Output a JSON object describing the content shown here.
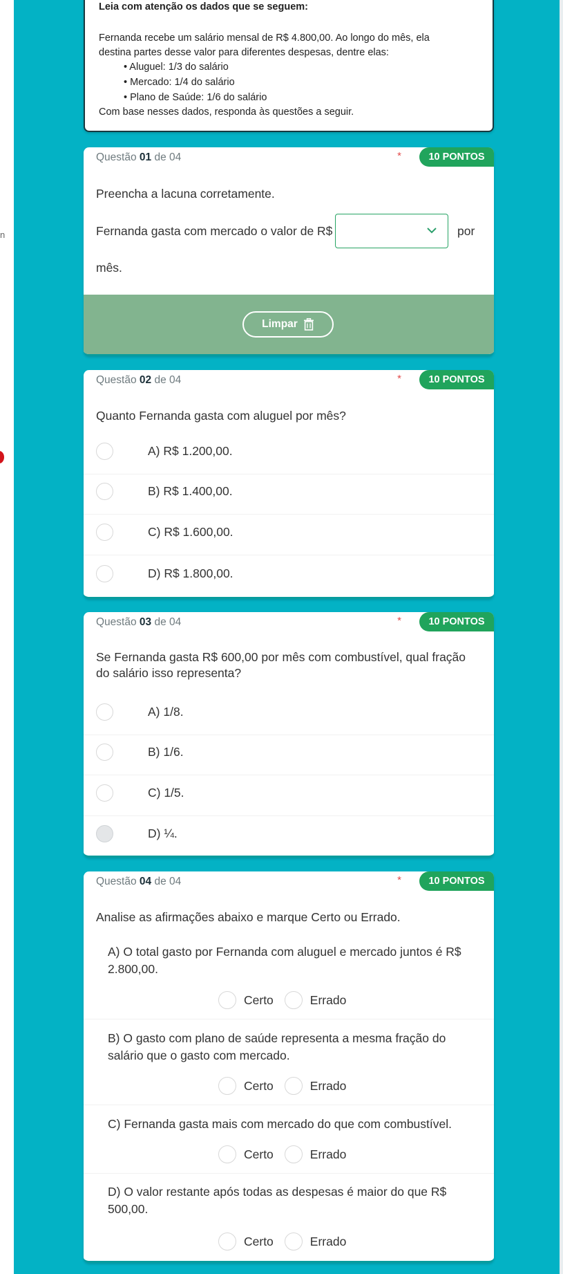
{
  "intro": {
    "title": "Leia com atenção os dados que se seguem:",
    "line1": "Fernanda recebe um salário mensal de R$ 4.800,00. Ao longo do mês, ela",
    "line2": "destina partes desse valor para diferentes despesas, dentre elas:",
    "bullets": [
      "• Aluguel: 1/3 do salário",
      "• Mercado: 1/4 do salário",
      "• Plano de Saúde: 1/6 do salário"
    ],
    "closing": "Com base nesses dados, responda às questões a seguir."
  },
  "left_edge_text": "n",
  "questions": [
    {
      "prefix": "Questão",
      "number": "01",
      "of": "de 04",
      "star": "*",
      "points": "10 PONTOS",
      "instruction": "Preencha a lacuna corretamente.",
      "sentence_before": "Fernanda gasta com mercado o valor de R$",
      "sentence_after": "por",
      "sentence_end": "mês.",
      "dropdown_value": "",
      "clear_label": "Limpar"
    },
    {
      "prefix": "Questão",
      "number": "02",
      "of": "de 04",
      "star": "*",
      "points": "10 PONTOS",
      "text": "Quanto Fernanda gasta com aluguel por mês?",
      "options": [
        "A) R$ 1.200,00.",
        "B) R$ 1.400,00.",
        "C) R$ 1.600,00.",
        "D) R$ 1.800,00."
      ]
    },
    {
      "prefix": "Questão",
      "number": "03",
      "of": "de 04",
      "star": "*",
      "points": "10 PONTOS",
      "text_line1": "Se Fernanda gasta R$ 600,00 por mês com combustível, qual fração",
      "text_line2": "do salário isso representa?",
      "options": [
        "A) 1/8.",
        "B) 1/6.",
        "C) 1/5.",
        "D) ¼."
      ]
    },
    {
      "prefix": "Questão",
      "number": "04",
      "of": "de 04",
      "star": "*",
      "points": "10 PONTOS",
      "text": "Analise as afirmações abaixo e marque Certo ou Errado.",
      "certo": "Certo",
      "errado": "Errado",
      "statements": [
        [
          "A) O total gasto por Fernanda com aluguel e mercado juntos é R$",
          "2.800,00."
        ],
        [
          "B) O gasto com plano de saúde representa a mesma fração do",
          "salário que o gasto com mercado."
        ],
        [
          "C) Fernanda gasta mais com mercado do que com combustível."
        ],
        [
          "D) O valor restante após todas as despesas é maior do que R$",
          "500,00."
        ]
      ]
    }
  ],
  "colors": {
    "teal": "#03b2c5",
    "green": "#20a45c",
    "clear_bar": "#82b48f"
  }
}
